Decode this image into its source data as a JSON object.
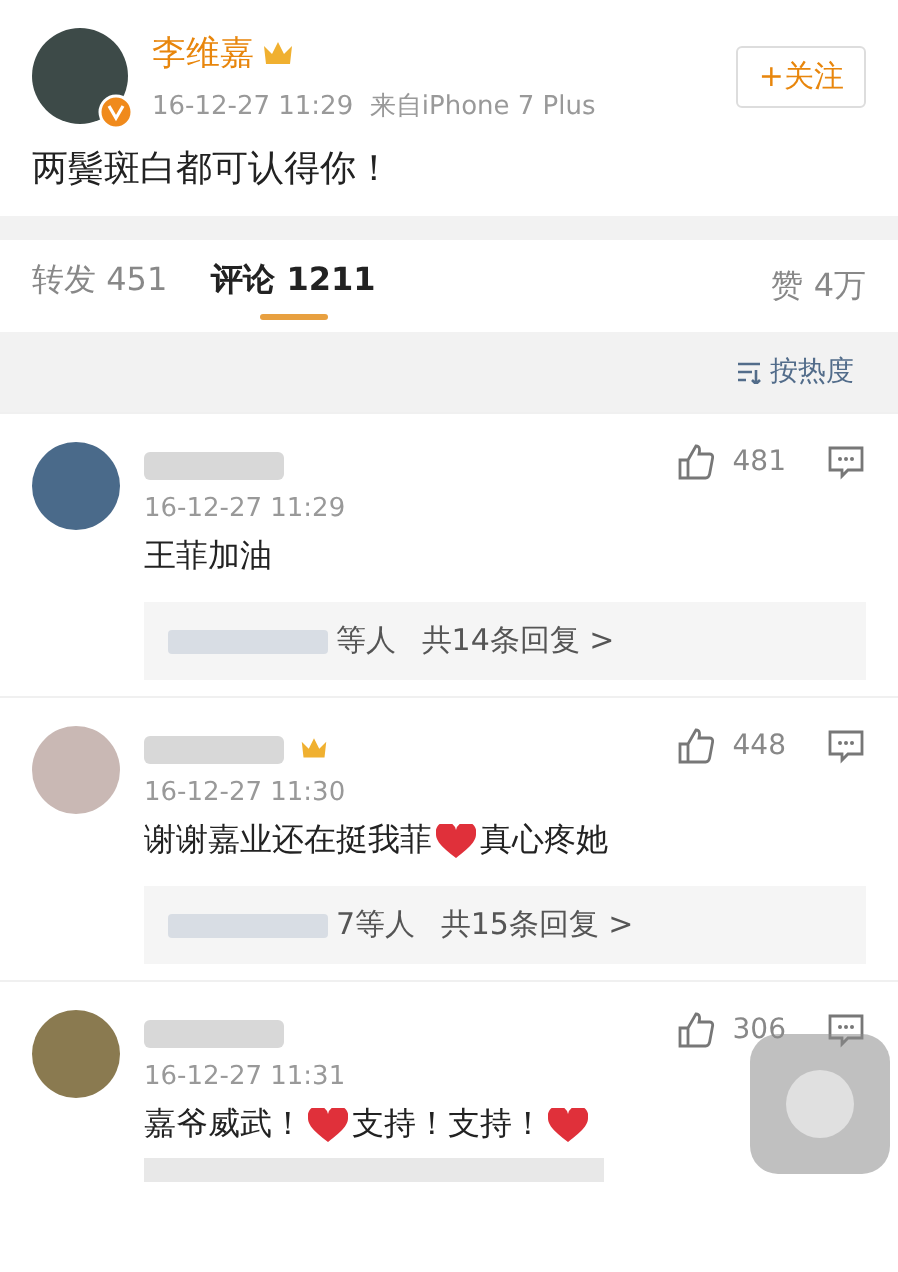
{
  "post": {
    "author": "李维嘉",
    "time": "16-12-27 11:29",
    "source": "来自iPhone 7 Plus",
    "follow_button": "+关注",
    "text": "两鬓斑白都可认得你！"
  },
  "tabs": [
    {
      "label": "转发 451",
      "selected": false
    },
    {
      "label": "评论 1211",
      "selected": true
    }
  ],
  "likes": "赞 4万",
  "sort": "按热度",
  "comments": [
    {
      "time": "16-12-27 11:29",
      "likes": "481",
      "badge": false,
      "content": [
        {
          "kind": "text",
          "text": "王菲加油"
        }
      ],
      "replies": {
        "who": "等人",
        "count": "共14条回复 >"
      }
    },
    {
      "time": "16-12-27 11:30",
      "likes": "448",
      "badge": true,
      "content": [
        {
          "kind": "text",
          "text": "谢谢嘉业还在挺我菲"
        },
        {
          "kind": "heart"
        },
        {
          "kind": "text",
          "text": "真心疼她"
        }
      ],
      "replies": {
        "who": "7等人",
        "count": "共15条回复 >"
      }
    },
    {
      "time": "16-12-27 11:31",
      "likes": "306",
      "badge": false,
      "content": [
        {
          "kind": "text",
          "text": "嘉爷威武！"
        },
        {
          "kind": "heart"
        },
        {
          "kind": "text",
          "text": "支持！支持！"
        },
        {
          "kind": "heart"
        }
      ]
    }
  ]
}
